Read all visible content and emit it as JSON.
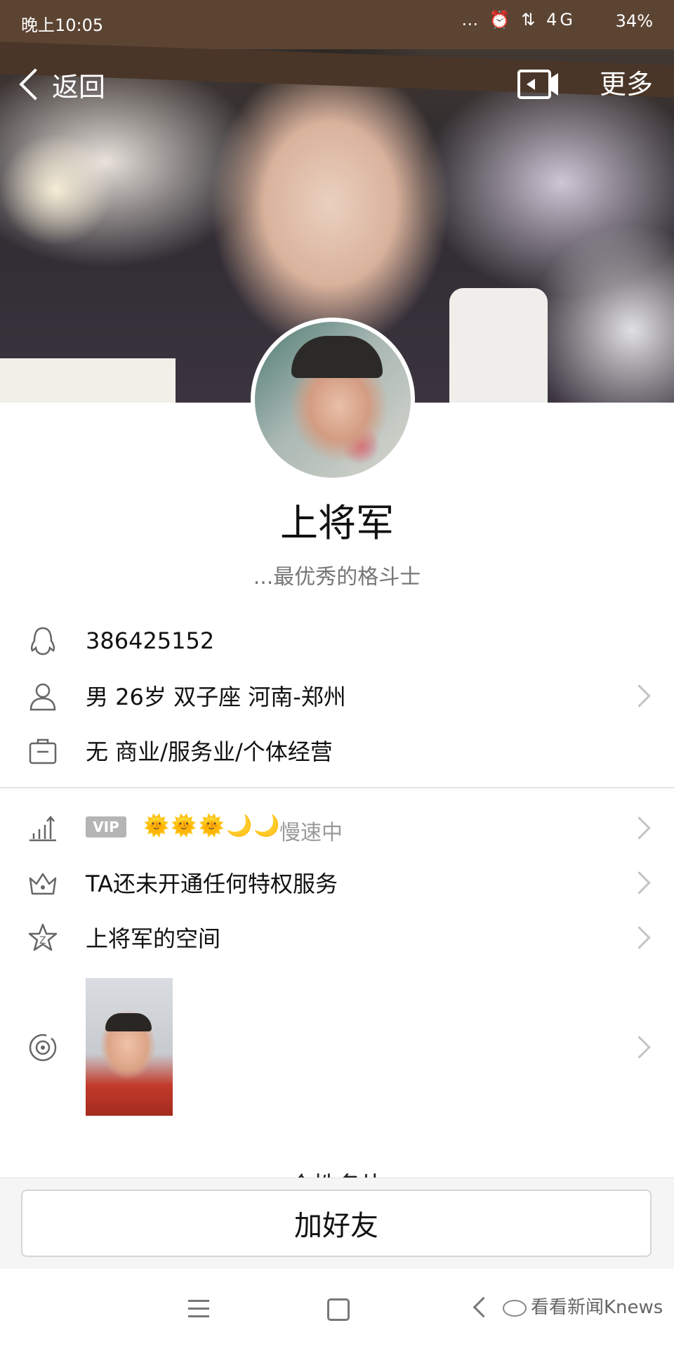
{
  "status_bar": {
    "time": "晚上10:05",
    "icons": "… ⏰ ⇅ 4G",
    "battery": "34%"
  },
  "nav": {
    "back_label": "返回",
    "more_label": "更多"
  },
  "profile": {
    "name": "上将军",
    "signature": "...最优秀的格斗士"
  },
  "info": {
    "qq_number": "386425152",
    "personal": "男  26岁  双子座  河南-郑州",
    "occupation": "无 商业/服务业/个体经营"
  },
  "privileges": {
    "vip_badge": "VIP",
    "vip_level": "🌞🌞🌞🌙🌙",
    "vip_status": "慢速中",
    "privilege_text": "TA还未开通任何特权服务",
    "space_text": "上将军的空间"
  },
  "hidden_section_title": "个性名片",
  "actions": {
    "add_friend": "加好友"
  },
  "watermark": "看看新闻Knews",
  "colors": {
    "accent": "#111111",
    "muted": "#9a9a9a",
    "vip_badge": "#b5b5b5"
  }
}
